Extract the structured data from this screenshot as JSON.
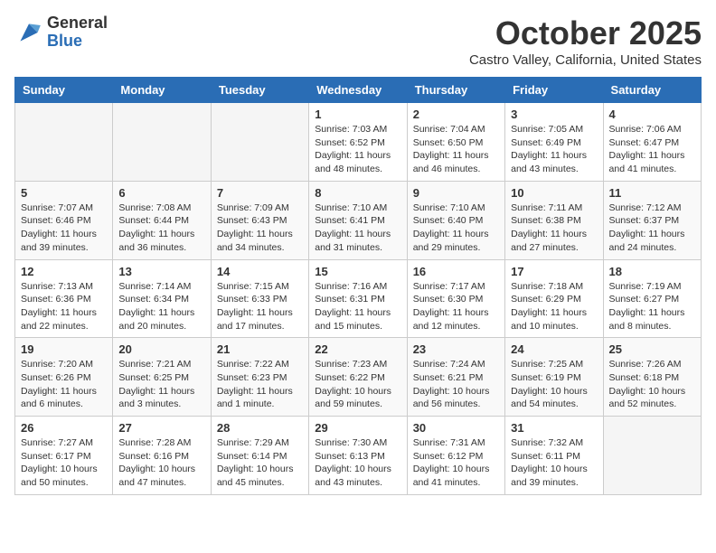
{
  "header": {
    "logo_general": "General",
    "logo_blue": "Blue",
    "month_title": "October 2025",
    "location": "Castro Valley, California, United States"
  },
  "weekdays": [
    "Sunday",
    "Monday",
    "Tuesday",
    "Wednesday",
    "Thursday",
    "Friday",
    "Saturday"
  ],
  "weeks": [
    [
      {
        "day": "",
        "empty": true
      },
      {
        "day": "",
        "empty": true
      },
      {
        "day": "",
        "empty": true
      },
      {
        "day": "1",
        "rise": "7:03 AM",
        "set": "6:52 PM",
        "daylight": "11 hours and 48 minutes."
      },
      {
        "day": "2",
        "rise": "7:04 AM",
        "set": "6:50 PM",
        "daylight": "11 hours and 46 minutes."
      },
      {
        "day": "3",
        "rise": "7:05 AM",
        "set": "6:49 PM",
        "daylight": "11 hours and 43 minutes."
      },
      {
        "day": "4",
        "rise": "7:06 AM",
        "set": "6:47 PM",
        "daylight": "11 hours and 41 minutes."
      }
    ],
    [
      {
        "day": "5",
        "rise": "7:07 AM",
        "set": "6:46 PM",
        "daylight": "11 hours and 39 minutes."
      },
      {
        "day": "6",
        "rise": "7:08 AM",
        "set": "6:44 PM",
        "daylight": "11 hours and 36 minutes."
      },
      {
        "day": "7",
        "rise": "7:09 AM",
        "set": "6:43 PM",
        "daylight": "11 hours and 34 minutes."
      },
      {
        "day": "8",
        "rise": "7:10 AM",
        "set": "6:41 PM",
        "daylight": "11 hours and 31 minutes."
      },
      {
        "day": "9",
        "rise": "7:10 AM",
        "set": "6:40 PM",
        "daylight": "11 hours and 29 minutes."
      },
      {
        "day": "10",
        "rise": "7:11 AM",
        "set": "6:38 PM",
        "daylight": "11 hours and 27 minutes."
      },
      {
        "day": "11",
        "rise": "7:12 AM",
        "set": "6:37 PM",
        "daylight": "11 hours and 24 minutes."
      }
    ],
    [
      {
        "day": "12",
        "rise": "7:13 AM",
        "set": "6:36 PM",
        "daylight": "11 hours and 22 minutes."
      },
      {
        "day": "13",
        "rise": "7:14 AM",
        "set": "6:34 PM",
        "daylight": "11 hours and 20 minutes."
      },
      {
        "day": "14",
        "rise": "7:15 AM",
        "set": "6:33 PM",
        "daylight": "11 hours and 17 minutes."
      },
      {
        "day": "15",
        "rise": "7:16 AM",
        "set": "6:31 PM",
        "daylight": "11 hours and 15 minutes."
      },
      {
        "day": "16",
        "rise": "7:17 AM",
        "set": "6:30 PM",
        "daylight": "11 hours and 12 minutes."
      },
      {
        "day": "17",
        "rise": "7:18 AM",
        "set": "6:29 PM",
        "daylight": "11 hours and 10 minutes."
      },
      {
        "day": "18",
        "rise": "7:19 AM",
        "set": "6:27 PM",
        "daylight": "11 hours and 8 minutes."
      }
    ],
    [
      {
        "day": "19",
        "rise": "7:20 AM",
        "set": "6:26 PM",
        "daylight": "11 hours and 6 minutes."
      },
      {
        "day": "20",
        "rise": "7:21 AM",
        "set": "6:25 PM",
        "daylight": "11 hours and 3 minutes."
      },
      {
        "day": "21",
        "rise": "7:22 AM",
        "set": "6:23 PM",
        "daylight": "11 hours and 1 minute."
      },
      {
        "day": "22",
        "rise": "7:23 AM",
        "set": "6:22 PM",
        "daylight": "10 hours and 59 minutes."
      },
      {
        "day": "23",
        "rise": "7:24 AM",
        "set": "6:21 PM",
        "daylight": "10 hours and 56 minutes."
      },
      {
        "day": "24",
        "rise": "7:25 AM",
        "set": "6:19 PM",
        "daylight": "10 hours and 54 minutes."
      },
      {
        "day": "25",
        "rise": "7:26 AM",
        "set": "6:18 PM",
        "daylight": "10 hours and 52 minutes."
      }
    ],
    [
      {
        "day": "26",
        "rise": "7:27 AM",
        "set": "6:17 PM",
        "daylight": "10 hours and 50 minutes."
      },
      {
        "day": "27",
        "rise": "7:28 AM",
        "set": "6:16 PM",
        "daylight": "10 hours and 47 minutes."
      },
      {
        "day": "28",
        "rise": "7:29 AM",
        "set": "6:14 PM",
        "daylight": "10 hours and 45 minutes."
      },
      {
        "day": "29",
        "rise": "7:30 AM",
        "set": "6:13 PM",
        "daylight": "10 hours and 43 minutes."
      },
      {
        "day": "30",
        "rise": "7:31 AM",
        "set": "6:12 PM",
        "daylight": "10 hours and 41 minutes."
      },
      {
        "day": "31",
        "rise": "7:32 AM",
        "set": "6:11 PM",
        "daylight": "10 hours and 39 minutes."
      },
      {
        "day": "",
        "empty": true
      }
    ]
  ]
}
